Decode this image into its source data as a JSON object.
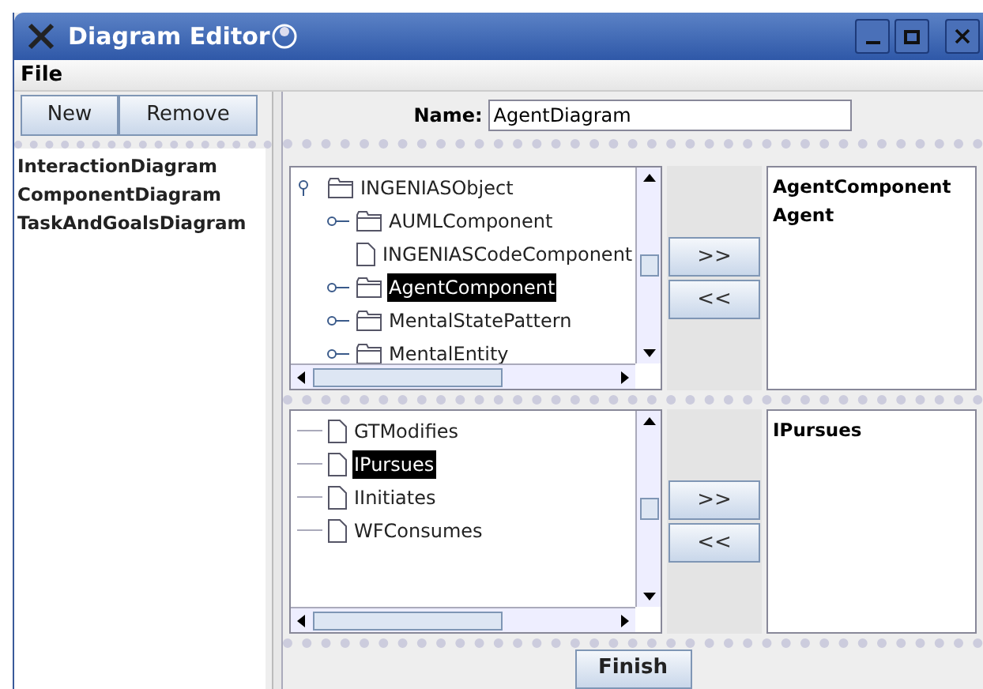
{
  "window": {
    "title": "Diagram Editor"
  },
  "menu": [
    "File"
  ],
  "left_buttons": [
    "New",
    "Remove"
  ],
  "diagrams": [
    {
      "label": "InteractionDiagram",
      "selected": false
    },
    {
      "label": "ComponentDiagram",
      "selected": false
    },
    {
      "label": "TaskAndGoalsDiagram",
      "selected": false
    }
  ],
  "name_field": {
    "label": "Name:",
    "value": "AgentDiagram"
  },
  "panels": [
    {
      "tree": [
        {
          "label": "INGENIASObject",
          "kind": "folder",
          "expanded": true,
          "selected": false,
          "children": [
            {
              "label": "AUMLComponent",
              "kind": "folder",
              "expanded": false,
              "selected": false
            },
            {
              "label": "INGENIASCodeComponent",
              "kind": "leaf",
              "selected": false
            },
            {
              "label": "AgentComponent",
              "kind": "folder",
              "expanded": false,
              "selected": true
            },
            {
              "label": "MentalStatePattern",
              "kind": "folder",
              "expanded": false,
              "selected": false
            },
            {
              "label": "MentalEntity",
              "kind": "folder",
              "expanded": false,
              "selected": false
            }
          ]
        }
      ],
      "buttons": [
        ">>",
        "<<"
      ],
      "chosen": [
        "AgentComponent",
        "Agent"
      ]
    },
    {
      "tree": [
        {
          "label": "GTModifies",
          "kind": "leaf",
          "selected": false
        },
        {
          "label": "IPursues",
          "kind": "leaf",
          "selected": true
        },
        {
          "label": "IInitiates",
          "kind": "leaf",
          "selected": false
        },
        {
          "label": "WFConsumes",
          "kind": "leaf",
          "selected": false
        }
      ],
      "buttons": [
        ">>",
        "<<"
      ],
      "chosen": [
        "IPursues"
      ]
    }
  ],
  "finish_button": "Finish"
}
